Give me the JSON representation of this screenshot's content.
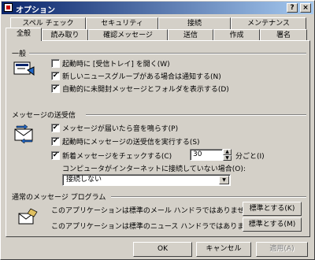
{
  "window": {
    "title": "オプション",
    "help_label": "?",
    "close_label": "×"
  },
  "tabs_row_back": [
    "スペル チェック",
    "セキュリティ",
    "接続",
    "メンテナンス"
  ],
  "tabs_row_front": [
    "全般",
    "読み取り",
    "確認メッセージ",
    "送信",
    "作成",
    "署名"
  ],
  "active_tab": "全般",
  "general": {
    "title": "一般",
    "options": [
      {
        "label": "起動時に [受信トレイ] を開く(W)",
        "checked": false
      },
      {
        "label": "新しいニュースグループがある場合は通知する(N)",
        "checked": true
      },
      {
        "label": "自動的に未開封メッセージとフォルダを表示する(D)",
        "checked": true
      }
    ]
  },
  "send_receive": {
    "title": "メッセージの送受信",
    "options": [
      {
        "label": "メッセージが届いたら音を鳴らす(P)",
        "checked": true
      },
      {
        "label": "起動時にメッセージの送受信を実行する(S)",
        "checked": true
      },
      {
        "label": "新着メッセージをチェックする(C)",
        "checked": true
      }
    ],
    "interval_value": "30",
    "interval_unit": "分ごと(I)",
    "offline_label": "コンピュータがインターネットに接続していない場合(O):",
    "offline_value": "接続しない"
  },
  "default_programs": {
    "title": "通常のメッセージ プログラム",
    "mail_text": "このアプリケーションは標準のメール ハンドラではありません。",
    "mail_button": "標準とする(K)",
    "news_text": "このアプリケーションは標準のニュース ハンドラではありません。",
    "news_button": "標準とする(M)"
  },
  "footer": {
    "ok": "OK",
    "cancel": "キャンセル",
    "apply": "適用(A)"
  },
  "colors": {
    "face": "#d4d0c8",
    "title_start": "#0a246a",
    "title_end": "#a6caf0",
    "check": "#000000"
  }
}
